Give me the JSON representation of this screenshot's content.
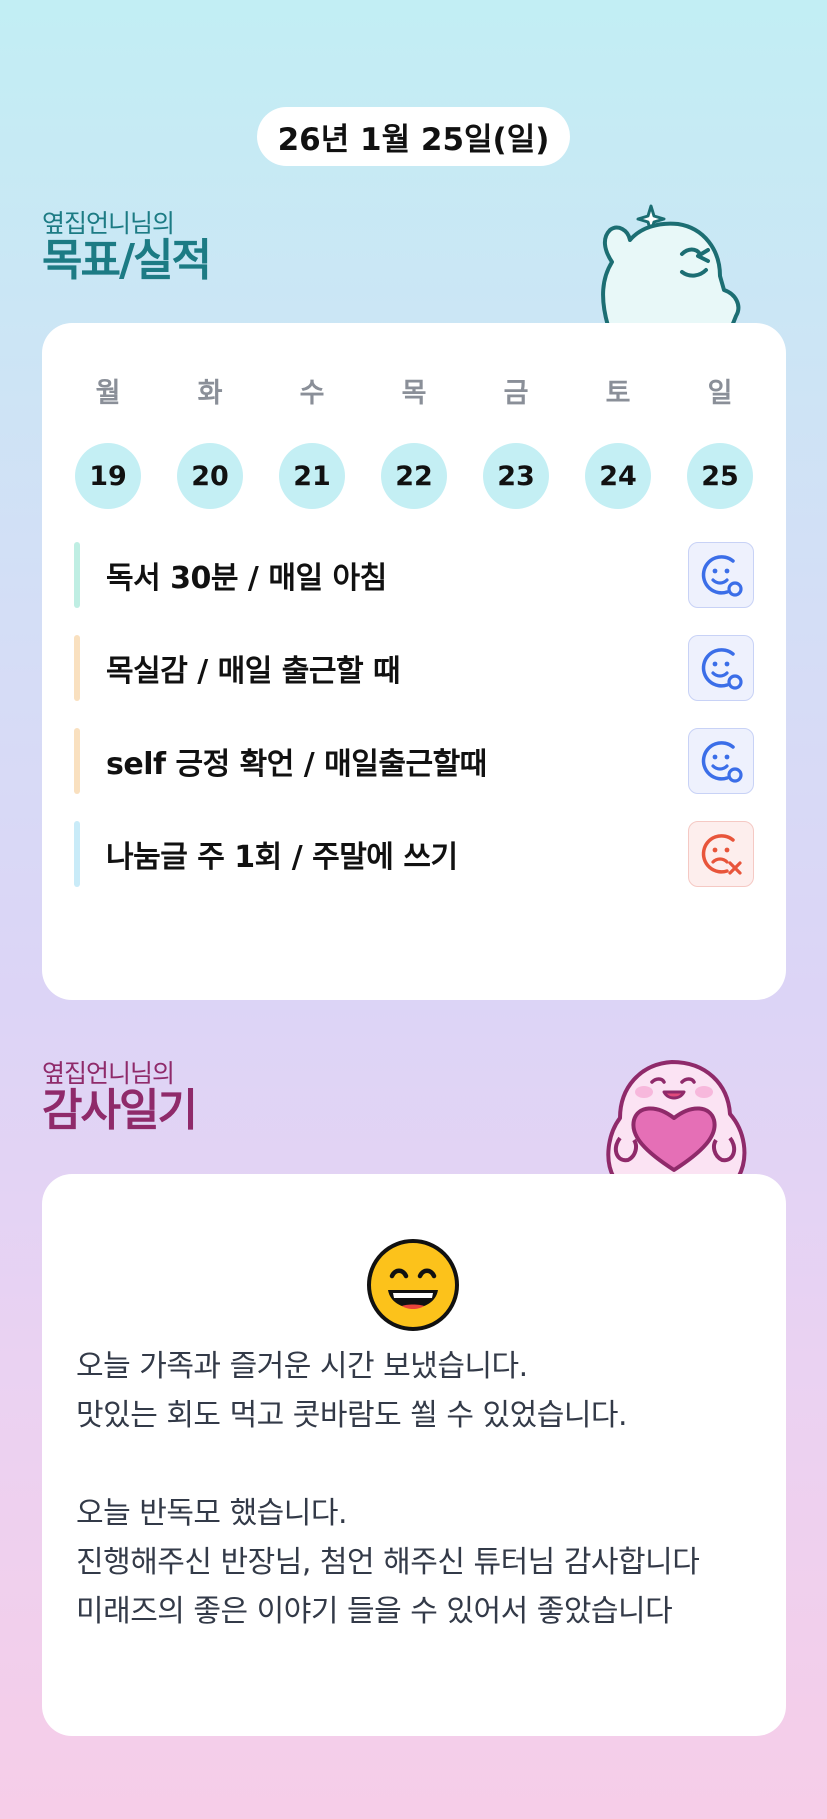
{
  "date": "26년 1월 25일(일)",
  "goals_section": {
    "owner": "옆집언니님의",
    "title": "목표/실적",
    "weekdays": [
      "월",
      "화",
      "수",
      "목",
      "금",
      "토",
      "일"
    ],
    "dates": [
      "19",
      "20",
      "21",
      "22",
      "23",
      "24",
      "25"
    ],
    "items": [
      {
        "text": "독서 30분 / 매일 아침",
        "bar_color": "#bfeee3",
        "status": "achieved",
        "icon": "smile-check-icon"
      },
      {
        "text": "목실감 / 매일 출근할 때",
        "bar_color": "#f9e0bf",
        "status": "achieved",
        "icon": "smile-check-icon"
      },
      {
        "text": "self 긍정 확언 / 매일출근할때",
        "bar_color": "#f9e0bf",
        "status": "achieved",
        "icon": "smile-check-icon"
      },
      {
        "text": "나눔글 주 1회 / 주말에 쓰기",
        "bar_color": "#c9ebf8",
        "status": "missed",
        "icon": "sad-x-icon"
      }
    ]
  },
  "diary_section": {
    "owner": "옆집언니님의",
    "title": "감사일기",
    "emoji": "grinning-face-icon",
    "text": "오늘 가족과 즐거운 시간 보냈습니다.\n맛있는 회도 먹고 콧바람도 쐴 수 있었습니다.\n\n오늘 반독모 했습니다.\n진행해주신 반장님, 첨언 해주신 튜터님 감사합니다\n미래즈의 좋은 이야기 들을 수 있어서 좋았습니다"
  },
  "colors": {
    "goals_title": "#1c7b84",
    "diary_title": "#8f2a6a",
    "date_circle": "#c4eff4",
    "achieved_icon": "#3b6ee8",
    "missed_icon": "#e8553b"
  }
}
